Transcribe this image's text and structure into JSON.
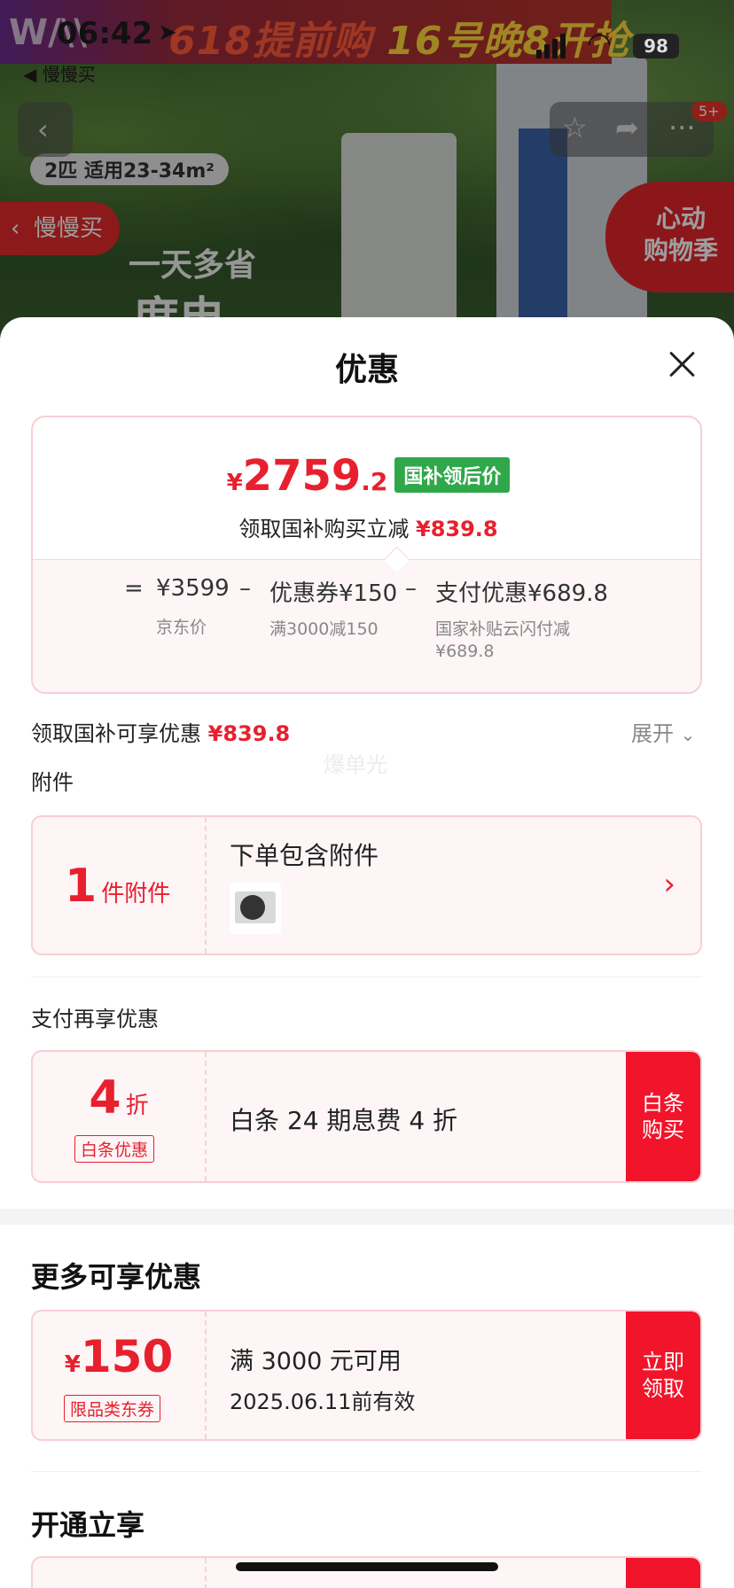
{
  "status_bar": {
    "time": "06:42",
    "location_arrow": "➤",
    "back_app_label": "◀ 慢慢买",
    "battery": "98"
  },
  "background": {
    "banner_logo": "W/\\\\",
    "banner_text_a": "618提前购",
    "banner_text_b": "16号晚8开抢",
    "spec_pill": "2匹 适用23-34m²",
    "slogan": "一天多省",
    "slogan2": "度电",
    "cart_badge": "5+",
    "back_to_app": "慢慢买",
    "promo_line1": "心动",
    "promo_line2": "购物季"
  },
  "sheet": {
    "title": "优惠",
    "price_card": {
      "currency": "¥",
      "price_int": "2759",
      "price_dec": ".2",
      "price_tag": "国补领后价",
      "saving_label": "领取国补购买立减",
      "saving_value": "¥839.8",
      "calc": {
        "eq": "=",
        "jd_price": "¥3599",
        "minus1": "–",
        "coupon": "优惠券¥150",
        "minus2": "–",
        "pay_discount": "支付优惠¥689.8",
        "jd_price_label": "京东价",
        "coupon_label": "满3000减150",
        "pay_label_1": "国家补贴云闪付减",
        "pay_label_2": "¥689.8"
      }
    },
    "subsidy_row": {
      "label": "领取国补可享优惠",
      "value": "¥839.8",
      "expand": "展开"
    },
    "watermark": "爆单光",
    "accessory": {
      "section_label": "附件",
      "count": "1",
      "count_unit": "件附件",
      "title": "下单包含附件",
      "chevron": "›"
    },
    "payment": {
      "section_label": "支付再享优惠",
      "discount": "4",
      "discount_unit": "折",
      "discount_tag": "白条优惠",
      "desc": "白条 24 期息费 4 折",
      "button_line1": "白条",
      "button_line2": "购买"
    },
    "more": {
      "section_title": "更多可享优惠",
      "currency": "¥",
      "amount": "150",
      "coupon_tag": "限品类东券",
      "condition": "满 3000 元可用",
      "expiry": "2025.06.11前有效",
      "button_line1": "立即",
      "button_line2": "领取"
    },
    "open": {
      "section_title": "开通立享"
    }
  }
}
